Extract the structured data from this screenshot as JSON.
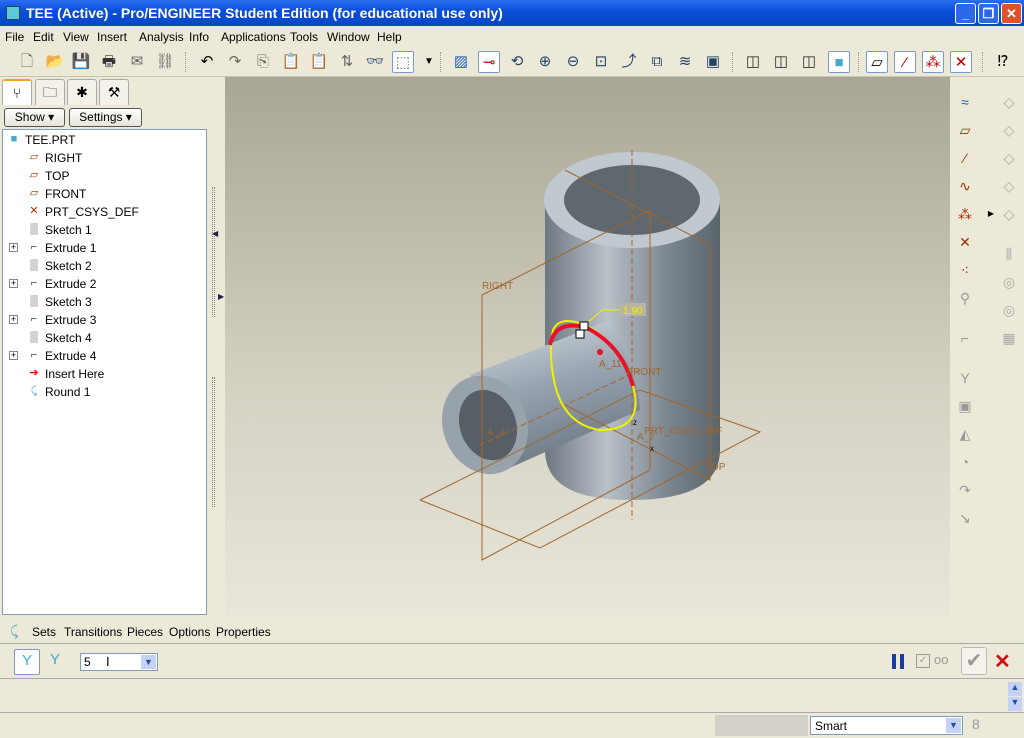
{
  "window": {
    "title": "TEE (Active) - Pro/ENGINEER Student Edition (for educational use only)"
  },
  "menu": [
    "File",
    "Edit",
    "View",
    "Insert",
    "Analysis",
    "Info",
    "Applications",
    "Tools",
    "Window",
    "Help"
  ],
  "panel": {
    "show_label": "Show",
    "settings_label": "Settings"
  },
  "tree": [
    {
      "label": "TEE.PRT",
      "icon": "part-icon",
      "expand": false
    },
    {
      "label": "RIGHT",
      "icon": "datum-plane-icon",
      "expand": false
    },
    {
      "label": "TOP",
      "icon": "datum-plane-icon",
      "expand": false
    },
    {
      "label": "FRONT",
      "icon": "datum-plane-icon",
      "expand": false
    },
    {
      "label": "PRT_CSYS_DEF",
      "icon": "csys-icon",
      "expand": false
    },
    {
      "label": "Sketch 1",
      "icon": "sketch-icon",
      "expand": false
    },
    {
      "label": "Extrude 1",
      "icon": "extrude-icon",
      "expand": true
    },
    {
      "label": "Sketch 2",
      "icon": "sketch-icon",
      "expand": false
    },
    {
      "label": "Extrude 2",
      "icon": "extrude-icon",
      "expand": true
    },
    {
      "label": "Sketch 3",
      "icon": "sketch-icon",
      "expand": false
    },
    {
      "label": "Extrude 3",
      "icon": "extrude-icon",
      "expand": true
    },
    {
      "label": "Sketch 4",
      "icon": "sketch-icon",
      "expand": false
    },
    {
      "label": "Extrude 4",
      "icon": "extrude-icon",
      "expand": true
    },
    {
      "label": "Insert Here",
      "icon": "insert-arrow-icon",
      "expand": false
    },
    {
      "label": "Round 1",
      "icon": "round-icon",
      "expand": false
    }
  ],
  "viewport": {
    "labels": {
      "right": "RIGHT",
      "front": "FRONT",
      "top": "TOP",
      "csys": "PRT_CSYS_DEF",
      "axis_a4": "A_4",
      "axis_a11": "A_11",
      "axis_a7": "A_7",
      "dimension": "1.90",
      "z": "z",
      "x": "x"
    }
  },
  "dashboard": {
    "tabs": [
      "Sets",
      "Transitions",
      "Pieces",
      "Options",
      "Properties"
    ],
    "radius_value": "5"
  },
  "status": {
    "filter": "Smart"
  },
  "colors": {
    "title_blue": "#0a4fd8",
    "selection_red": "#e8102a",
    "highlight_yellow": "#f0f000",
    "datum_orange": "#a0662a"
  }
}
